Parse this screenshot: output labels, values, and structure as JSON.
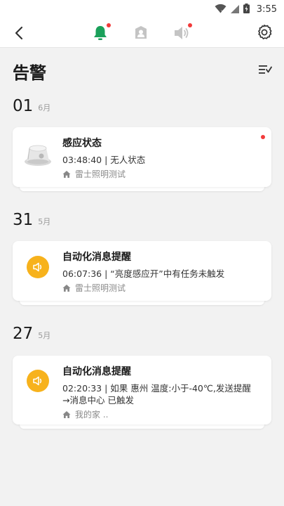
{
  "status_bar": {
    "time": "3:55"
  },
  "nav": {
    "tabs": [
      {
        "name": "bell",
        "active": true,
        "badge": true
      },
      {
        "name": "contact",
        "active": false,
        "badge": false
      },
      {
        "name": "speaker",
        "active": false,
        "badge": true
      }
    ]
  },
  "page": {
    "title": "告警"
  },
  "groups": [
    {
      "day": "01",
      "month": "6月",
      "card": {
        "title": "感应状态",
        "detail": "03:48:40 | 无人状态",
        "home": "雷士照明测试",
        "icon": "sensor-device-icon",
        "unread": true
      }
    },
    {
      "day": "31",
      "month": "5月",
      "card": {
        "title": "自动化消息提醒",
        "detail": "06:07:36 | “亮度感应开”中有任务未触发",
        "home": "雷士照明测试",
        "icon": "speaker-icon",
        "unread": false
      }
    },
    {
      "day": "27",
      "month": "5月",
      "card": {
        "title": "自动化消息提醒",
        "detail": "02:20:33 | 如果 惠州 温度:小于-40℃,发送提醒→消息中心 已触发",
        "home": "我的家 ..",
        "icon": "speaker-icon",
        "unread": false
      }
    }
  ],
  "colors": {
    "accent_green": "#1aa05a",
    "alert_red": "#f23a3a",
    "icon_orange": "#f7b21c",
    "icon_gray": "#c4c4c4"
  }
}
